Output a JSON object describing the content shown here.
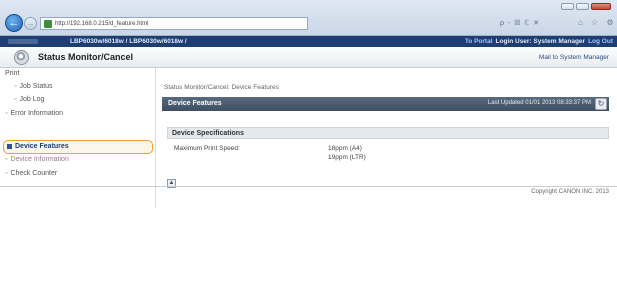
{
  "browser": {
    "url": "http://192.168.0.215/d_feature.html",
    "back_icon": "arrow-left-icon",
    "forward_icon": "arrow-right-icon",
    "tools": "ρ - ☒ ℂ ✕",
    "stars": "⌂ ☆ ⚙"
  },
  "app_band": {
    "path": "LBP6030w/6018w / LBP6030w/6018w /",
    "portal_link": "To Portal",
    "login_label": "Login User: System Manager",
    "logout_link": "Log Out"
  },
  "title_row": {
    "title": "Status Monitor/Cancel",
    "mail_link": "Mail to System Manager"
  },
  "sidebar": {
    "section_print": "Print",
    "job_status": "Job Status",
    "job_log": "Job Log",
    "error_information": "Error Information",
    "device_features": "Device Features",
    "device_information": "Device Information",
    "check_counter": "Check Counter"
  },
  "main": {
    "breadcrumb": "Status Monitor/Cancel: Device Features",
    "section_title": "Device Features",
    "last_updated": "Last Updated 01/01 2013 08:33:37 PM",
    "sub_title": "Device Specifications",
    "spec_label": "Maximum Print Speed:",
    "spec_value_a4": "18ppm (A4)",
    "spec_value_ltr": "19ppm (LTR)"
  },
  "footer": {
    "copyright": "Copyright CANON INC. 2013"
  }
}
